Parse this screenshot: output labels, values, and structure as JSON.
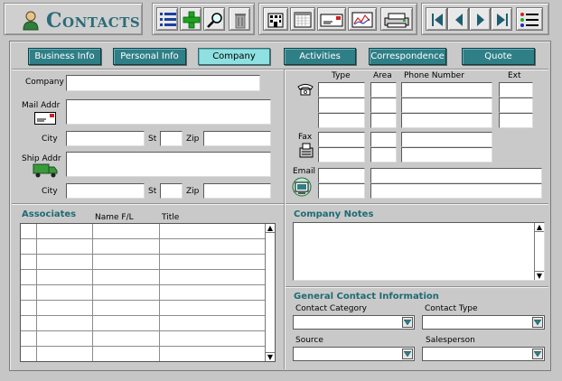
{
  "window": {
    "title": "Contacts"
  },
  "toolbar": {
    "icons": [
      "list-icon",
      "add-icon",
      "find-icon",
      "trash-icon",
      "building-icon",
      "calendar-icon",
      "envelope-icon",
      "report-icon",
      "print-icon",
      "first-record-icon",
      "previous-record-icon",
      "next-record-icon",
      "last-record-icon",
      "menu-list-icon"
    ]
  },
  "tabs": [
    {
      "label": "Business Info"
    },
    {
      "label": "Personal Info"
    },
    {
      "label": "Company",
      "active": true
    },
    {
      "label": "Activities"
    },
    {
      "label": "Correspondence"
    },
    {
      "label": "Quote"
    }
  ],
  "company_form": {
    "company_label": "Company",
    "mail_addr_label": "Mail Addr",
    "city_label": "City",
    "st_label": "St",
    "zip_label": "Zip",
    "ship_addr_label": "Ship Addr",
    "city2_label": "City",
    "st2_label": "St",
    "zip2_label": "Zip"
  },
  "phone": {
    "col_type": "Type",
    "col_area": "Area",
    "col_number": "Phone Number",
    "col_ext": "Ext",
    "fax_label": "Fax",
    "email_label": "Email"
  },
  "associates": {
    "title": "Associates",
    "col_name": "Name F/L",
    "col_title": "Title",
    "rows": 9
  },
  "company_notes": {
    "title": "Company Notes"
  },
  "general_info": {
    "title": "General Contact Information",
    "contact_category_label": "Contact Category",
    "contact_type_label": "Contact Type",
    "source_label": "Source",
    "salesperson_label": "Salesperson"
  },
  "colors": {
    "accent": "#2f7f87",
    "active_tab": "#8fe0e0",
    "title_text": "#2c6b78",
    "section_title": "#1f6a73"
  }
}
